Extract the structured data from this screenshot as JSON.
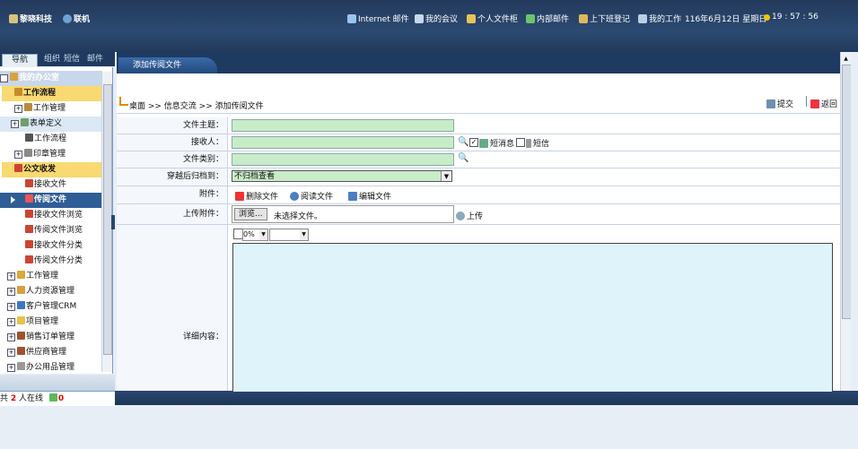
{
  "header": {
    "company": "黎晓科技",
    "user": "联机",
    "links": [
      "Internet 邮件",
      "我的会议",
      "个人文件柜",
      "内部邮件",
      "上下班登记",
      "我的工作"
    ],
    "date": "116年6月12日 星期日",
    "time": "19 : 57 : 56"
  },
  "nav_tabs": [
    "导航",
    "组织",
    "短信",
    "邮件"
  ],
  "sidebar": {
    "items": [
      {
        "label": "我的办公室",
        "icon": "office-icon"
      },
      {
        "label": "工作流程",
        "icon": "workflow-icon"
      },
      {
        "label": "工作管理",
        "icon": "workflow-icon"
      },
      {
        "label": "表单定义",
        "icon": "form-icon"
      },
      {
        "label": "工作流程",
        "icon": "workflow-icon"
      },
      {
        "label": "印章管理",
        "icon": "seal-icon"
      },
      {
        "label": "公文收发",
        "icon": "document-icon"
      },
      {
        "label": "接收文件",
        "icon": "document-icon"
      },
      {
        "label": "传阅文件",
        "icon": "document-icon"
      },
      {
        "label": "接收文件浏览",
        "icon": "document-icon"
      },
      {
        "label": "传阅文件浏览",
        "icon": "document-icon"
      },
      {
        "label": "接收文件分类",
        "icon": "document-icon"
      },
      {
        "label": "传阅文件分类",
        "icon": "document-icon"
      },
      {
        "label": "工作管理",
        "icon": "workflow-icon"
      },
      {
        "label": "人力资源管理",
        "icon": "hr-icon"
      },
      {
        "label": "客户管理CRM",
        "icon": "crm-icon"
      },
      {
        "label": "项目管理",
        "icon": "project-icon"
      },
      {
        "label": "销售订单管理",
        "icon": "sales-icon"
      },
      {
        "label": "供应商管理",
        "icon": "supplier-icon"
      },
      {
        "label": "办公用品管理",
        "icon": "supplies-icon"
      }
    ]
  },
  "status": {
    "prefix": "共",
    "online_count": "2",
    "suffix": "人在线",
    "msg_count": "0"
  },
  "tab": {
    "title": "添加传阅文件"
  },
  "breadcrumb": "桌面 >> 信息交流 >> 添加传阅文件",
  "actions": {
    "submit": "提交",
    "back": "返回"
  },
  "form": {
    "subject_label": "文件主题：",
    "recipient_label": "接收人：",
    "sms_label": "短消息",
    "text_msg_label": "短信",
    "category_label": "文件类别：",
    "archive_label": "穿越后归档到：",
    "archive_value": "不归档查看",
    "attachment_label": "附件：",
    "delete_file": "删除文件",
    "read_file": "阅读文件",
    "edit_file": "编辑文件",
    "upload_label": "上传附件：",
    "browse_button": "浏览...",
    "no_file": "未选择文件。",
    "upload_button": "上传",
    "detail_label": "详细内容：",
    "zoom_value": "0%"
  }
}
